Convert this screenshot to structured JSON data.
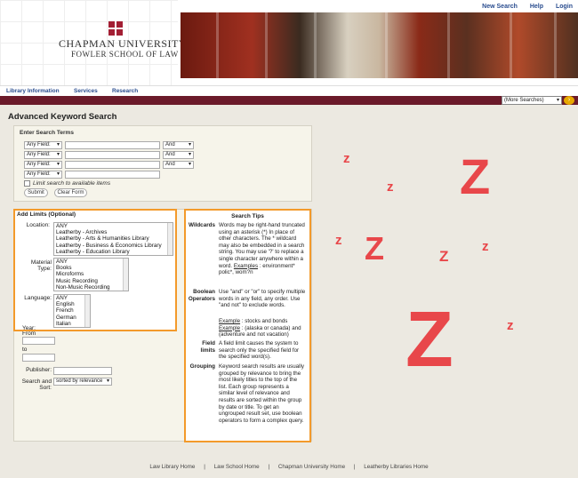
{
  "header": {
    "logo_line1": "CHAPMAN UNIVERSITY",
    "logo_line2": "FOWLER SCHOOL OF LAW",
    "links": [
      "New Search",
      "Help",
      "Login"
    ]
  },
  "nav": {
    "items": [
      "Library Information",
      "Services",
      "Research"
    ],
    "more_select": "(More Searches)",
    "go_icon": "arrow-right-icon"
  },
  "page_title": "Advanced Keyword Search",
  "search_terms": {
    "title": "Enter Search Terms",
    "rows": [
      {
        "field": "Any Field:",
        "op": "And"
      },
      {
        "field": "Any Field:",
        "op": "And"
      },
      {
        "field": "Any Field:",
        "op": "And"
      },
      {
        "field": "Any Field:"
      }
    ],
    "limit_label": "Limit search to available items",
    "submit": "Submit",
    "clear": "Clear Form"
  },
  "limits": {
    "title": "Add Limits (Optional)",
    "location_label": "Location:",
    "locations": [
      "ANY",
      "Leatherby - Archives",
      "Leatherby - Arts & Humanities Library",
      "Leatherby - Business & Economics Library",
      "Leatherby - Education Library"
    ],
    "material_label_1": "Material",
    "material_label_2": "Type:",
    "materials": [
      "ANY",
      "Books",
      "Microforms",
      "Music Recording",
      "Non-Music Recording"
    ],
    "language_label": "Language:",
    "languages": [
      "ANY",
      "English",
      "French",
      "German",
      "Italian"
    ],
    "year_label": "Year:",
    "from_label": "From",
    "to_label": "to",
    "publisher_label": "Publisher:",
    "search_sort_label_1": "Search and",
    "search_sort_label_2": "Sort:",
    "sort_value": "sorted by relevance"
  },
  "tips": {
    "title": "Search Tips",
    "wildcards_term": "Wildcards",
    "wildcards_text": "Words may be right-hand truncated using an asterisk (*) In place of other characters. The * wildcard may also be embedded in a search string. You may use '?' to replace a single character anywhere within a word.",
    "wildcards_example_label": "Examples",
    "wildcards_example": ": environment* polic*, wom?n",
    "boolean_term_1": "Boolean",
    "boolean_term_2": "Operators",
    "boolean_text": "Use \"and\" or \"or\" to specify multiple words in any field, any order. Use \"and not\" to exclude words.",
    "boolean_example1_label": "Example",
    "boolean_example1": ": stocks and bonds",
    "boolean_example2_label": "Example",
    "boolean_example2": ": (alaska or canada) and (adventure and not vacation)",
    "field_term_1": "Field",
    "field_term_2": "limits",
    "field_text": "A field limit causes the system to search only the specified field for the specified word(s).",
    "grouping_term": "Grouping",
    "grouping_text": "Keyword search results are usually grouped by relevance to bring the most likely titles to the top of the list. Each group represents a similar level of relevance and results are sorted within the group by date or title. To get an ungrouped result set, use boolean operators to form a complex query."
  },
  "footer": {
    "links": [
      "Law Library Home",
      "Law School Home",
      "Chapman University Home",
      "Leatherby Libraries Home"
    ],
    "separator": "|"
  },
  "overlay": {
    "letter": "Z",
    "small_letter": "z",
    "color": "#e8474a"
  }
}
